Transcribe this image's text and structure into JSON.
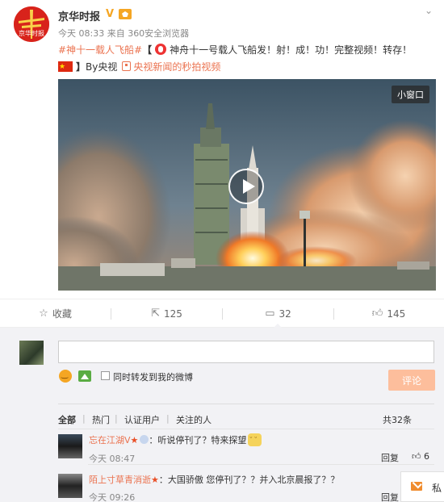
{
  "header": {
    "author": "京华时报",
    "verified_mark": "V",
    "more_label": "⌄",
    "meta": "今天 08:33 来自 360安全浏览器"
  },
  "post": {
    "topic_tag": "#神十一载人飞船#",
    "open_bracket": "【",
    "headline": "神舟十一号载人飞船发！射！成！功！完整视频！转存！",
    "close_bracket": "】",
    "source_prefix": "By央视",
    "link_text": "央视新闻的秒拍视频"
  },
  "video": {
    "mini_window_label": "小窗口"
  },
  "actions": {
    "favorite_label": "收藏",
    "repost_count": "125",
    "comment_count": "32",
    "like_count": "145"
  },
  "comment_box": {
    "also_repost_label": "同时转发到我的微博",
    "submit_label": "评论"
  },
  "filters": {
    "all": "全部",
    "hot": "热门",
    "verified": "认证用户",
    "following": "关注的人",
    "total": "共32条"
  },
  "comments": [
    {
      "user": "忘在江湖V",
      "text": "：听说停刊了？特来探望",
      "time": "今天 08:47",
      "reply_label": "回复",
      "likes": "6"
    },
    {
      "user": "陌上寸草青消逝",
      "text": "：大国骄傲  您停刊了？？并入北京晨报了？？",
      "time": "今天 09:26",
      "reply_label": "回复"
    }
  ],
  "float_panel": {
    "label": "私"
  }
}
